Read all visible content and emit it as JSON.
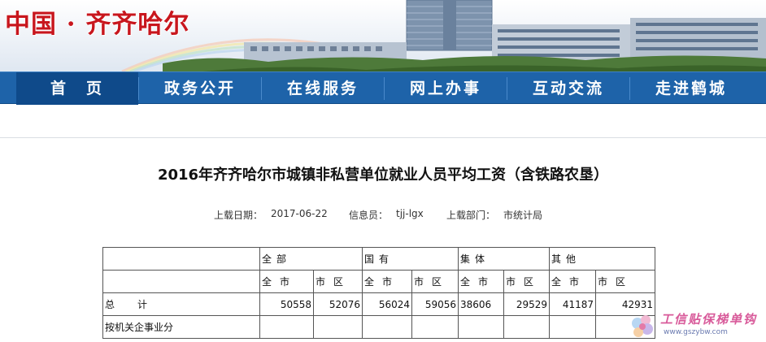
{
  "banner": {
    "title": "中国 · 齐齐哈尔"
  },
  "nav": {
    "items": [
      {
        "label": "首　页",
        "active": true
      },
      {
        "label": "政务公开"
      },
      {
        "label": "在线服务"
      },
      {
        "label": "网上办事"
      },
      {
        "label": "互动交流"
      },
      {
        "label": "走进鹤城"
      }
    ]
  },
  "article": {
    "title": "2016年齐齐哈尔市城镇非私营单位就业人员平均工资（含铁路农垦）",
    "meta": {
      "date_label": "上载日期：",
      "date_value": "2017-06-22",
      "author_label": "信息员：",
      "author_value": "tjj-lgx",
      "dept_label": "上载部门：",
      "dept_value": "市统计局"
    }
  },
  "table": {
    "groups": [
      "全部",
      "国有",
      "集体",
      "其他"
    ],
    "subs": [
      "全市",
      "市区"
    ],
    "rows": [
      {
        "label": "总　计",
        "values": [
          "50558",
          "52076",
          "56024",
          "59056",
          "38606",
          "29529",
          "41187",
          "42931"
        ]
      },
      {
        "label": "按机关企事业分",
        "values": [
          "",
          "",
          "",
          "",
          "",
          "",
          "",
          ""
        ]
      }
    ]
  },
  "watermark": {
    "text": "工信贴保梯单钩",
    "url": "www.gszybw.com"
  },
  "colors": {
    "brand_red": "#c8161d",
    "nav_blue": "#1e63a9",
    "nav_active": "#0f4a8a"
  }
}
